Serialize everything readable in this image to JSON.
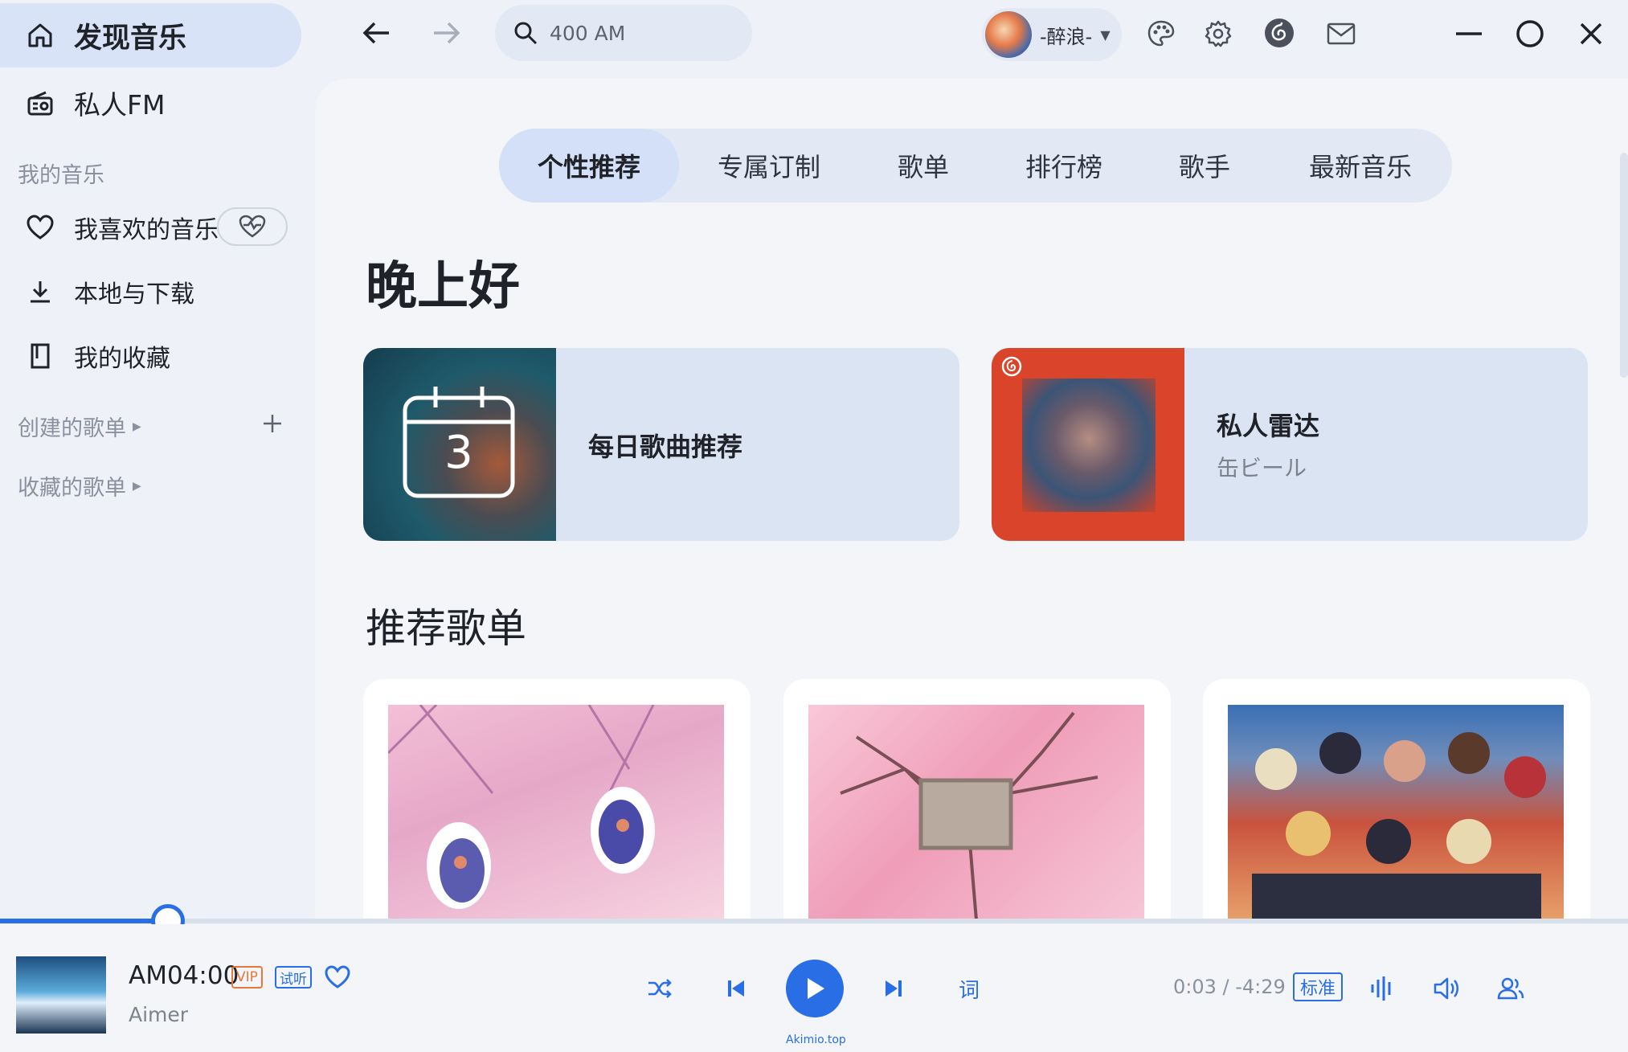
{
  "sidebar": {
    "discover_label": "发现音乐",
    "fm_label": "私人FM",
    "my_music_header": "我的音乐",
    "liked_label": "我喜欢的音乐",
    "local_label": "本地与下载",
    "collection_label": "我的收藏",
    "created_playlists_label": "创建的歌单",
    "collected_playlists_label": "收藏的歌单"
  },
  "topbar": {
    "search_text": "400 AM",
    "username": "-醉浪-"
  },
  "tabs": [
    {
      "label": "个性推荐"
    },
    {
      "label": "专属订制"
    },
    {
      "label": "歌单"
    },
    {
      "label": "排行榜"
    },
    {
      "label": "歌手"
    },
    {
      "label": "最新音乐"
    }
  ],
  "main": {
    "greeting": "晚上好",
    "daily_card": {
      "day_number": "3",
      "title": "每日歌曲推荐"
    },
    "radar_card": {
      "title": "私人雷达",
      "subtitle": "缶ビール"
    },
    "recommended_title": "推荐歌单"
  },
  "player": {
    "song_title": "AM04:00",
    "vip_badge": "VIP",
    "trial_badge": "试听",
    "artist": "Aimer",
    "lyrics_label": "词",
    "watermark": "Akimio.top",
    "time": "0:03 / -4:29",
    "quality": "标准",
    "progress_fraction": 0.012
  },
  "colors": {
    "accent": "#2a6ee6",
    "vip": "#e8783a",
    "sidebar_active": "#d8e3f7"
  }
}
